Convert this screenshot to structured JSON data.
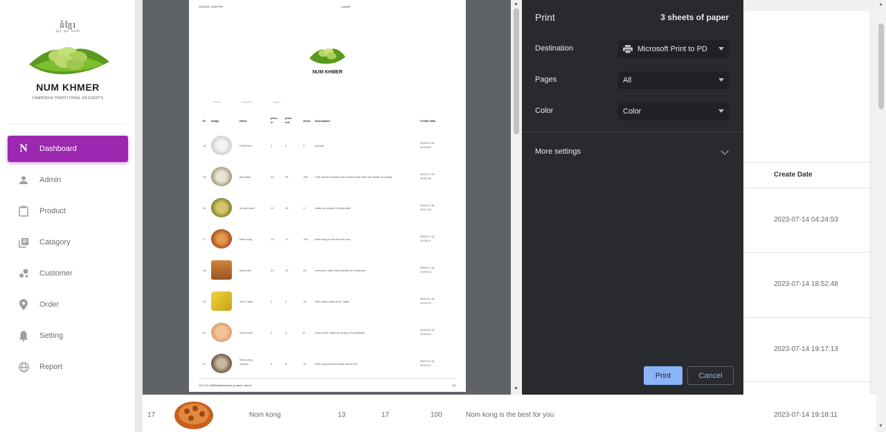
{
  "brand": {
    "khmer_text": "នំខ្មែរ",
    "khmer_sub": "ឆ្ងាញ់ · ស្អាត · អនាម័យ",
    "title": "NUM KHMER",
    "tagline": "CAMBODIA TRADITIONAL DESSERTS",
    "accent": "#9c27b0"
  },
  "sidebar": {
    "items": [
      {
        "label": "Dashboard",
        "icon": "letter-n-icon",
        "active": true
      },
      {
        "label": "Admin",
        "icon": "person-icon"
      },
      {
        "label": "Product",
        "icon": "clipboard-icon"
      },
      {
        "label": "Catagory",
        "icon": "library-icon"
      },
      {
        "label": "Customer",
        "icon": "bubbles-icon"
      },
      {
        "label": "Order",
        "icon": "location-pin-icon"
      },
      {
        "label": "Setting",
        "icon": "bell-icon"
      },
      {
        "label": "Report",
        "icon": "globe-icon"
      }
    ]
  },
  "background_table": {
    "header_create_date": "Create Date",
    "dates": [
      "2023-07-14 04:24:53",
      "2023-07-14 18:52:48",
      "2023-07-14 19:17:13"
    ],
    "visible_row": {
      "id": "17",
      "name": "Nom kong",
      "price_in": "13",
      "price_out": "17",
      "stock": "100",
      "description": "Nom kong is the best for you",
      "create_date": "2023-07-14 19:18:11"
    }
  },
  "print_preview": {
    "header_left": "11/02/23, 15:59 PM",
    "header_center": "Laravel",
    "brand_title": "NUM KHMER",
    "toolbar": [
      "PRINT",
      "EXPORT",
      "BACK"
    ],
    "columns": [
      "ID",
      "Image",
      "Name",
      "price in",
      "price out",
      "stock",
      "Description",
      "Create Date"
    ],
    "rows": [
      {
        "id": "13",
        "name": "NOM Pla i",
        "price_in": "1",
        "price_out": "2",
        "stock": "0",
        "description": "yummy",
        "date": "2023-07-14 04:24:53"
      },
      {
        "id": "15",
        "name": "jek khtao",
        "price_in": "12",
        "price_out": "15",
        "stock": "100",
        "description": "This dessert create from banana and there are water for eating",
        "date": "2023-07-14 18:52:48"
      },
      {
        "id": "16",
        "name": "An som jruk",
        "price_in": "12",
        "price_out": "15",
        "stock": "3",
        "description": "make by people of cambodai",
        "date": "2023-07-14 19:17:13"
      },
      {
        "id": "17",
        "name": "Nom kong",
        "price_in": "13",
        "price_out": "17",
        "stock": "100",
        "description": "Nom kong is the best for you",
        "date": "2023-07-14 19:18:11"
      },
      {
        "id": "18",
        "name": "Nom pum",
        "price_in": "12",
        "price_out": "19",
        "stock": "20",
        "description": "nom pum make from people of cambodai",
        "date": "2023-07-14 19:19:14"
      },
      {
        "id": "19",
        "name": "Nom Trasit",
        "price_in": "1",
        "price_out": "2",
        "stock": "10",
        "description": "Nom trasit make from Trasit",
        "date": "2023-07-14 19:22:10"
      },
      {
        "id": "20",
        "name": "Nom kroch",
        "price_in": "2",
        "price_out": "4",
        "stock": "8",
        "description": "Nom kroch make by people of cambodia",
        "date": "2023-07-14 19:23:10"
      },
      {
        "id": "21",
        "name": "Nom pong Ansom",
        "price_in": "3",
        "price_out": "5",
        "stock": "11",
        "description": "Nom pong Ansom make about rice",
        "date": "2023-07-14 19:24:21"
      }
    ],
    "footer_url": "127.0.0.1:8000/admin/view_product_report",
    "footer_page": "1/3"
  },
  "print_dialog": {
    "title": "Print",
    "sheets": "3 sheets of paper",
    "destination_label": "Destination",
    "destination_value": "Microsoft Print to PD",
    "pages_label": "Pages",
    "pages_value": "All",
    "color_label": "Color",
    "color_value": "Color",
    "more_settings": "More settings",
    "print_button": "Print",
    "cancel_button": "Cancel"
  }
}
